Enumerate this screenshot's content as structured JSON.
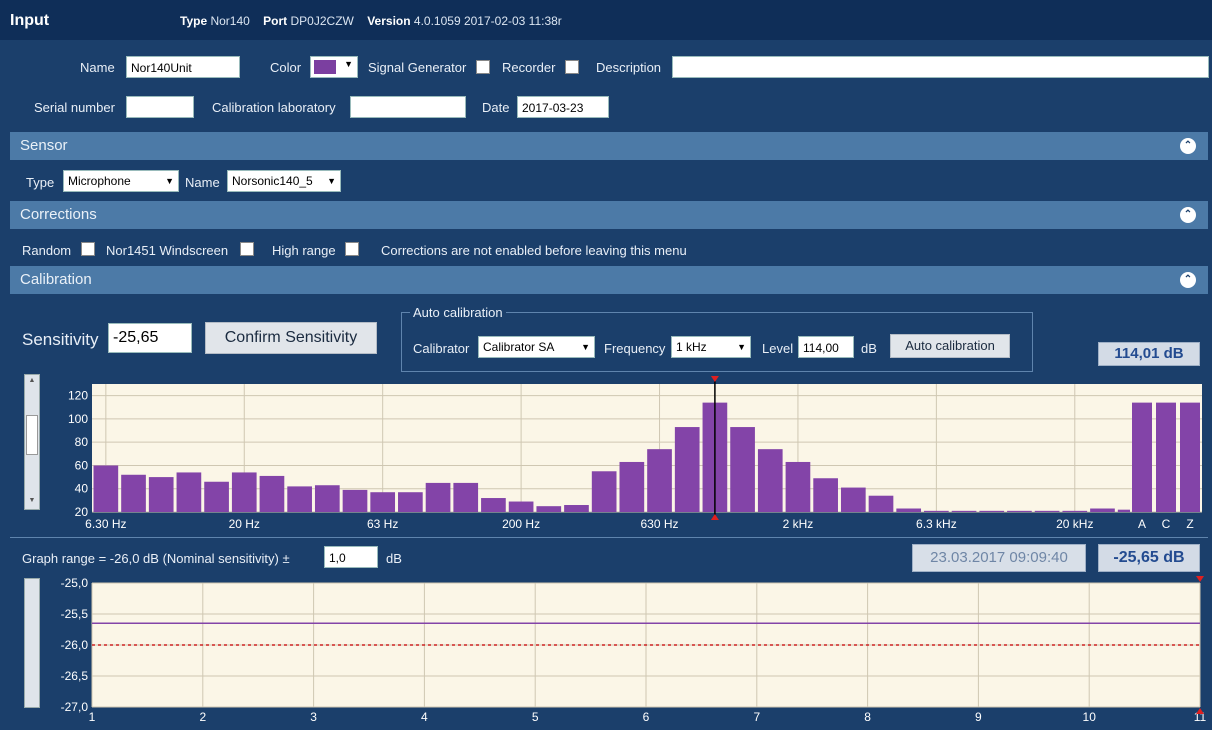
{
  "header": {
    "title": "Input",
    "type_label": "Type",
    "type_value": "Nor140",
    "port_label": "Port",
    "port_value": "DP0J2CZW",
    "version_label": "Version",
    "version_value": "4.0.1059  2017-02-03 11:38r"
  },
  "device": {
    "name_label": "Name",
    "name_value": "Nor140Unit",
    "color_label": "Color",
    "color_value": "#7b3fa0",
    "signal_generator_label": "Signal Generator",
    "recorder_label": "Recorder",
    "description_label": "Description",
    "serial_label": "Serial number",
    "cal_lab_label": "Calibration laboratory",
    "date_label": "Date",
    "date_value": "2017-03-23"
  },
  "sensor": {
    "title": "Sensor",
    "type_label": "Type",
    "type_value": "Microphone",
    "name_label": "Name",
    "name_value": "Norsonic140_5"
  },
  "corrections": {
    "title": "Corrections",
    "random_label": "Random",
    "windscreen_label": "Nor1451 Windscreen",
    "high_range_label": "High range",
    "note": "Corrections are not enabled before leaving this menu"
  },
  "calibration": {
    "title": "Calibration",
    "sensitivity_label": "Sensitivity",
    "sensitivity_value": "-25,65",
    "confirm_button": "Confirm Sensitivity",
    "auto_group_label": "Auto calibration",
    "calibrator_label": "Calibrator",
    "calibrator_value": "Calibrator SA",
    "frequency_label": "Frequency",
    "frequency_value": "1 kHz",
    "level_label": "Level",
    "level_value": "114,00",
    "level_unit": "dB",
    "auto_button": "Auto calibration",
    "level_readout": "114,01 dB",
    "graph_range_label": "Graph range = -26,0 dB (Nominal sensitivity) ±",
    "graph_range_value": "1,0",
    "graph_range_unit": "dB",
    "timestamp": "23.03.2017 09:09:40",
    "sensitivity_readout": "-25,65 dB"
  },
  "chart_data": [
    {
      "type": "bar",
      "x_tick_labels": [
        "6.30 Hz",
        "20 Hz",
        "63 Hz",
        "200 Hz",
        "630 Hz",
        "2 kHz",
        "6.3 kHz",
        "20 kHz"
      ],
      "y_tick_labels": [
        "120",
        "100",
        "80",
        "60",
        "40",
        "20"
      ],
      "ylim": [
        20,
        130
      ],
      "values": [
        60,
        52,
        50,
        54,
        46,
        54,
        51,
        42,
        43,
        39,
        37,
        37,
        45,
        45,
        32,
        29,
        25,
        26,
        55,
        63,
        74,
        93,
        114,
        93,
        74,
        63,
        49,
        41,
        34,
        23,
        21,
        21,
        21,
        21,
        21,
        21,
        23,
        22
      ],
      "cursor_index": 22,
      "bar_color": "#8344a8",
      "grid": true
    },
    {
      "type": "bar",
      "categories": [
        "A",
        "C",
        "Z"
      ],
      "values": [
        114,
        114,
        114
      ],
      "ylim": [
        20,
        130
      ],
      "bar_color": "#8344a8"
    },
    {
      "type": "line",
      "x_tick_labels": [
        "1",
        "2",
        "3",
        "4",
        "5",
        "6",
        "7",
        "8",
        "9",
        "10",
        "11"
      ],
      "y_tick_labels": [
        "-25,0",
        "-25,5",
        "-26,0",
        "-26,5",
        "-27,0"
      ],
      "xlim": [
        1,
        11
      ],
      "ylim": [
        -27.0,
        -25.0
      ],
      "series": [
        {
          "values": [
            -25.65,
            -25.65
          ],
          "x": [
            1,
            11
          ],
          "color": "#8344a8"
        }
      ],
      "reference_line": -26.0,
      "reference_color": "#cc2222",
      "grid": true
    }
  ]
}
